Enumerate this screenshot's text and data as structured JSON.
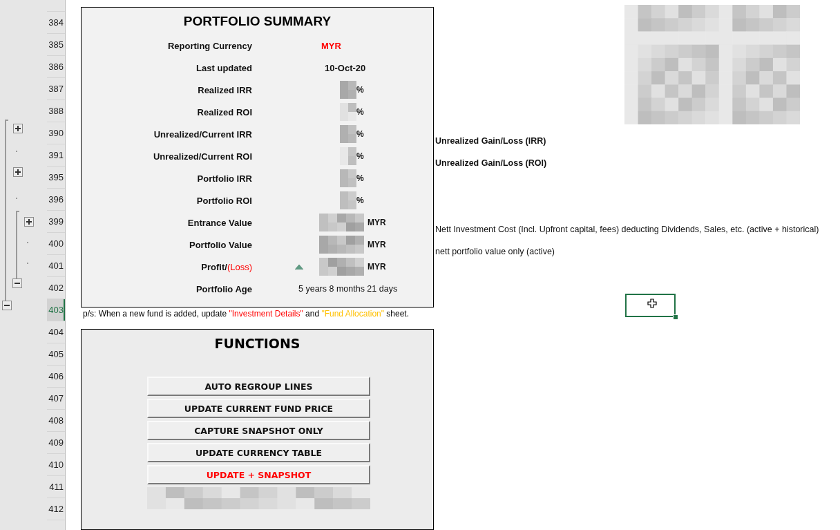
{
  "row_headers": [
    {
      "label": "384",
      "selected": false
    },
    {
      "label": "385",
      "selected": false
    },
    {
      "label": "386",
      "selected": false
    },
    {
      "label": "387",
      "selected": false
    },
    {
      "label": "388",
      "selected": false
    },
    {
      "label": "390",
      "selected": false
    },
    {
      "label": "391",
      "selected": false
    },
    {
      "label": "395",
      "selected": false
    },
    {
      "label": "396",
      "selected": false
    },
    {
      "label": "399",
      "selected": false
    },
    {
      "label": "400",
      "selected": false
    },
    {
      "label": "401",
      "selected": false
    },
    {
      "label": "402",
      "selected": false
    },
    {
      "label": "403",
      "selected": true
    },
    {
      "label": "404",
      "selected": false
    },
    {
      "label": "405",
      "selected": false
    },
    {
      "label": "406",
      "selected": false
    },
    {
      "label": "407",
      "selected": false
    },
    {
      "label": "408",
      "selected": false
    },
    {
      "label": "409",
      "selected": false
    },
    {
      "label": "410",
      "selected": false
    },
    {
      "label": "411",
      "selected": false
    },
    {
      "label": "412",
      "selected": false
    }
  ],
  "outline_controls": [
    {
      "expanded": false
    },
    {
      "expanded": false
    },
    {
      "expanded": false
    },
    {
      "expanded": true
    },
    {
      "expanded": true
    }
  ],
  "portfolio_summary": {
    "title": "PORTFOLIO SUMMARY",
    "rows": [
      {
        "label": "Reporting Currency",
        "kind": "accent",
        "value": "MYR"
      },
      {
        "label": "Last updated",
        "kind": "date",
        "value": "10-Oct-20"
      },
      {
        "label": "Realized IRR",
        "kind": "percent",
        "unit": "%"
      },
      {
        "label": "Realized ROI",
        "kind": "percent",
        "unit": "%"
      },
      {
        "label": "Unrealized/Current IRR",
        "kind": "percent",
        "unit": "%",
        "note": {
          "text": "Unrealized Gain/Loss (IRR)",
          "bold": true
        }
      },
      {
        "label": "Unrealized/Current ROI",
        "kind": "percent",
        "unit": "%",
        "note": {
          "text": "Unrealized Gain/Loss (ROI)",
          "bold": true
        }
      },
      {
        "label": "Portfolio IRR",
        "kind": "percent",
        "unit": "%"
      },
      {
        "label": "Portfolio ROI",
        "kind": "percent",
        "unit": "%"
      },
      {
        "label": "Entrance Value",
        "kind": "amount",
        "unit": "MYR",
        "note": {
          "text": "Nett Investment Cost (Incl. Upfront capital, fees) deducting Dividends, Sales, etc. (active + historical)",
          "bold": false
        }
      },
      {
        "label": "Portfolio Value",
        "kind": "amount",
        "unit": "MYR",
        "note": {
          "text": "nett portfolio value only (active)",
          "bold": false
        }
      },
      {
        "label": "Profit/",
        "label_suffix": "(Loss)",
        "kind": "amount",
        "unit": "MYR",
        "rising": true
      },
      {
        "label": "Portfolio Age",
        "kind": "plain",
        "value": "5 years 8 months 21 days"
      }
    ]
  },
  "footnote": [
    {
      "text": "p/s: When a new fund is added, update ",
      "color": "#000000"
    },
    {
      "text": "\"Investment Details\"",
      "color": "#ff0000"
    },
    {
      "text": " and ",
      "color": "#000000"
    },
    {
      "text": "\"Fund Allocation\"",
      "color": "#ffc000"
    },
    {
      "text": " sheet.",
      "color": "#000000"
    }
  ],
  "functions": {
    "title": "FUNCTIONS",
    "buttons": [
      {
        "label": "AUTO REGROUP LINES",
        "emphasis": false
      },
      {
        "label": "UPDATE CURRENT FUND PRICE",
        "emphasis": false
      },
      {
        "label": "CAPTURE SNAPSHOT ONLY",
        "emphasis": false
      },
      {
        "label": "UPDATE CURRENCY TABLE",
        "emphasis": false
      },
      {
        "label": "UPDATE + SNAPSHOT",
        "emphasis": true
      }
    ]
  }
}
